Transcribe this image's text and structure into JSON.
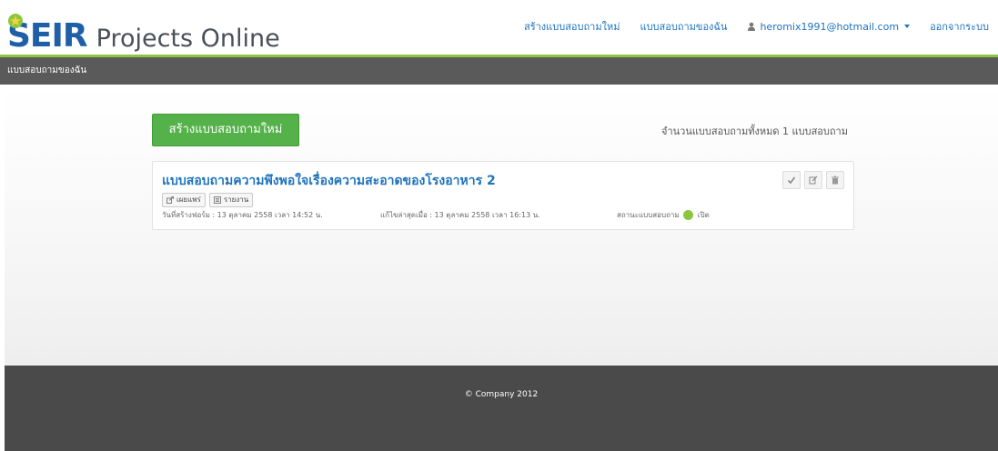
{
  "logo": {
    "primary": "SEIR",
    "secondary": "Projects Online"
  },
  "nav": {
    "create_new": "สร้างแบบสอบถามใหม่",
    "my_surveys": "แบบสอบถามของฉัน",
    "user_email": "heromix1991@hotmail.com",
    "logout": "ออกจากระบบ"
  },
  "breadcrumb": {
    "current": "แบบสอบถามของฉัน"
  },
  "main": {
    "create_button": "สร้างแบบสอบถามใหม่",
    "survey_count_text": "จำนวนแบบสอบถามทั้งหมด 1 แบบสอบถาม"
  },
  "surveys": [
    {
      "title": "แบบสอบถามความพึงพอใจเรื่องความสะอาดของโรงอาหาร 2",
      "publish_label": "เผยแพร่",
      "report_label": "รายงาน",
      "created": "วันที่สร้างฟอร์ม : 13 ตุลาคม 2558 เวลา 14:52 น.",
      "modified": "แก้ไขล่าสุดเมื่อ : 13 ตุลาคม 2558 เวลา 16:13 น.",
      "status_label": "สถานะแบบสอบถาม",
      "status_value": "เปิด",
      "status_color": "#8cc63f"
    }
  ],
  "footer": {
    "copyright": "© Company 2012"
  },
  "colors": {
    "accent_green": "#55b24a",
    "link_blue": "#1e73be",
    "logo_blue": "#1e5fa8",
    "bar_dark": "#5a5a5a"
  }
}
